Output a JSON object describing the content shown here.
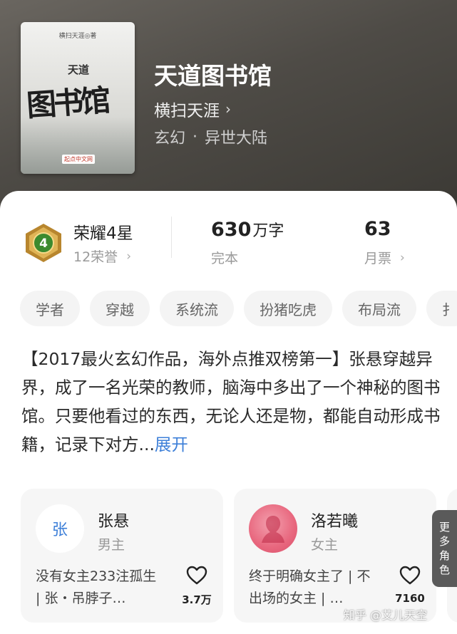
{
  "book": {
    "title": "天道图书馆",
    "author": "横扫天涯",
    "genre": "玄幻",
    "subgenre": "异世大陆",
    "genre_separator": "·",
    "cover": {
      "author_line": "横扫天涯◎著",
      "small_title": "天道",
      "big_title": "图书馆",
      "publisher": "起点中文网"
    }
  },
  "stats": {
    "honor_title": "荣耀4星",
    "honor_sub": "12荣誉",
    "badge_level": "4",
    "word_count": "630",
    "word_unit": "万字",
    "status": "完本",
    "monthly_tickets": "63",
    "tickets_label": "月票"
  },
  "tags": [
    "学者",
    "穿越",
    "系统流",
    "扮猪吃虎",
    "布局流",
    "扌"
  ],
  "description": {
    "text": "【2017最火玄幻作品，海外点推双榜第一】张悬穿越异界，成了一名光荣的教师，脑海中多出了一个神秘的图书馆。只要他看过的东西，无论人还是物，都能自动形成书籍，记录下对方...",
    "expand": "展开"
  },
  "characters": [
    {
      "avatar_text": "张",
      "name": "张悬",
      "role": "男主",
      "note": "没有女主233注孤生 | 张・吊脖子…",
      "likes": "3.7万"
    },
    {
      "avatar_text": "",
      "name": "洛若曦",
      "role": "女主",
      "note": "终于明确女主了 | 不出场的女主 | …",
      "likes": "7160"
    }
  ],
  "more_roles": "更多角色",
  "watermark": "知乎 @艾儿天空",
  "colors": {
    "accent": "#3d7fd8",
    "avatar_pink": "#e8677e",
    "badge_gold": "#c99a3a",
    "badge_green": "#3c8a2e"
  },
  "icons": [
    "chevron-right-icon",
    "heart-icon",
    "honor-badge-icon"
  ]
}
